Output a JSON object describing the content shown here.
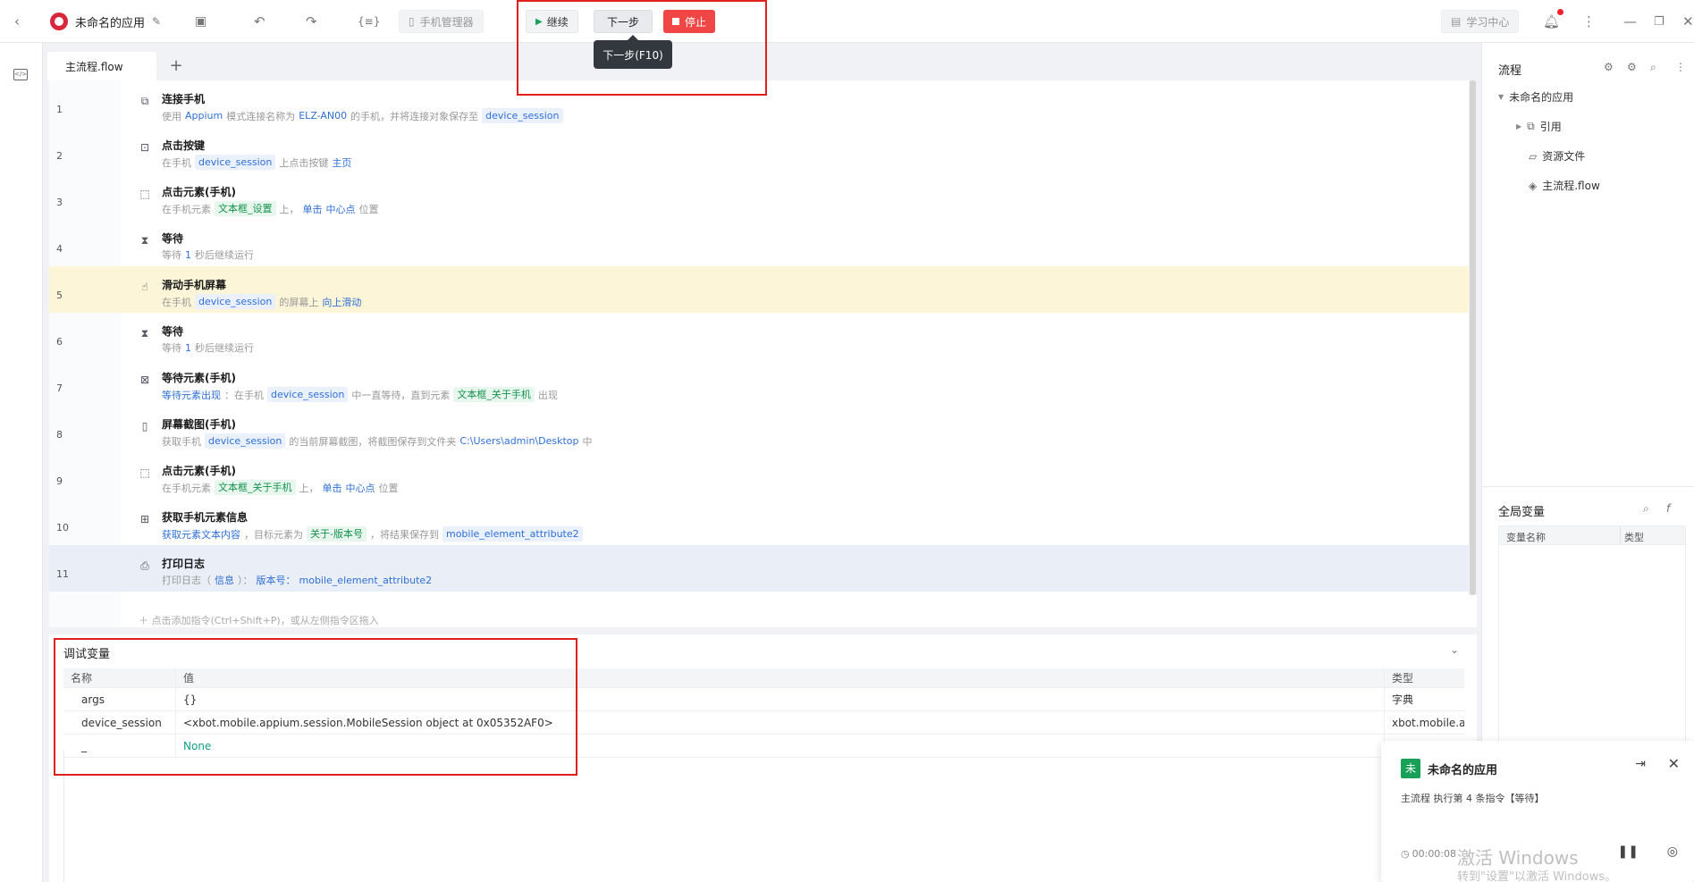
{
  "app": {
    "name": "未命名的应用"
  },
  "toolbar": {
    "phone_manager": "手机管理器",
    "continue_label": "继续",
    "next_label": "下一步",
    "stop_label": "停止",
    "next_tooltip": "下一步(F10)",
    "learning_center": "学习中心"
  },
  "tabs": {
    "active": "主流程.flow"
  },
  "flow": [
    {
      "num": "1",
      "icon": "connect-phone-icon",
      "title": "连接手机",
      "desc": [
        {
          "t": "使用"
        },
        {
          "t": "Appium",
          "k": "kw"
        },
        {
          "t": "模式连接名称为"
        },
        {
          "t": "ELZ-AN00",
          "k": "kw"
        },
        {
          "t": "的手机，并将连接对象保存至"
        },
        {
          "t": "device_session",
          "k": "tag"
        }
      ]
    },
    {
      "num": "2",
      "icon": "click-key-icon",
      "title": "点击按键",
      "desc": [
        {
          "t": "在手机"
        },
        {
          "t": "device_session",
          "k": "tag"
        },
        {
          "t": "上点击按键"
        },
        {
          "t": "主页",
          "k": "kw"
        }
      ]
    },
    {
      "num": "3",
      "icon": "click-element-icon",
      "title": "点击元素(手机)",
      "desc": [
        {
          "t": "在手机元素"
        },
        {
          "t": "文本框_设置",
          "k": "tagg"
        },
        {
          "t": "上，"
        },
        {
          "t": "单击",
          "k": "kw"
        },
        {
          "t": "中心点",
          "k": "kw"
        },
        {
          "t": "位置"
        }
      ]
    },
    {
      "num": "4",
      "icon": "hourglass-icon",
      "title": "等待",
      "desc": [
        {
          "t": "等待"
        },
        {
          "t": "1",
          "k": "kw"
        },
        {
          "t": "秒后继续运行"
        }
      ]
    },
    {
      "num": "5",
      "icon": "swipe-icon",
      "title": "滑动手机屏幕",
      "desc": [
        {
          "t": "在手机"
        },
        {
          "t": "device_session",
          "k": "tag"
        },
        {
          "t": "的屏幕上"
        },
        {
          "t": "向上滑动",
          "k": "kw"
        }
      ]
    },
    {
      "num": "6",
      "icon": "hourglass-icon",
      "title": "等待",
      "desc": [
        {
          "t": "等待"
        },
        {
          "t": "1",
          "k": "kw"
        },
        {
          "t": "秒后继续运行"
        }
      ]
    },
    {
      "num": "7",
      "icon": "wait-element-icon",
      "title": "等待元素(手机)",
      "desc": [
        {
          "t": "等待元素出现",
          "k": "kw"
        },
        {
          "t": "：在手机"
        },
        {
          "t": "device_session",
          "k": "tag"
        },
        {
          "t": "中一直等待，直到元素"
        },
        {
          "t": "文本框_关于手机",
          "k": "tagg"
        },
        {
          "t": "出现"
        }
      ]
    },
    {
      "num": "8",
      "icon": "screenshot-icon",
      "title": "屏幕截图(手机)",
      "desc": [
        {
          "t": "获取手机"
        },
        {
          "t": "device_session",
          "k": "tag"
        },
        {
          "t": "的当前屏幕截图，将截图保存到文件夹"
        },
        {
          "t": "C:\\Users\\admin\\Desktop",
          "k": "kw"
        },
        {
          "t": "中"
        }
      ]
    },
    {
      "num": "9",
      "icon": "click-element-icon",
      "title": "点击元素(手机)",
      "desc": [
        {
          "t": "在手机元素"
        },
        {
          "t": "文本框_关于手机",
          "k": "tagg"
        },
        {
          "t": "上，"
        },
        {
          "t": "单击",
          "k": "kw"
        },
        {
          "t": "中心点",
          "k": "kw"
        },
        {
          "t": "位置"
        }
      ]
    },
    {
      "num": "10",
      "icon": "element-info-icon",
      "title": "获取手机元素信息",
      "desc": [
        {
          "t": "获取元素文本内容",
          "k": "kw"
        },
        {
          "t": "，目标元素为"
        },
        {
          "t": "关于-版本号",
          "k": "tagg"
        },
        {
          "t": "，将结果保存到"
        },
        {
          "t": "mobile_element_attribute2",
          "k": "tag"
        }
      ]
    },
    {
      "num": "11",
      "icon": "print-log-icon",
      "title": "打印日志",
      "desc": [
        {
          "t": "打印日志（"
        },
        {
          "t": "信息",
          "k": "kw"
        },
        {
          "t": "）："
        },
        {
          "t": "版本号：",
          "k": "kw"
        },
        {
          "t": "mobile_element_attribute2",
          "k": "kw"
        }
      ]
    }
  ],
  "add_hint": "＋ 点击添加指令(Ctrl+Shift+P)，或从左侧指令区拖入",
  "debug": {
    "title": "调试变量",
    "headers": {
      "name": "名称",
      "value": "值",
      "type": "类型"
    },
    "rows": [
      {
        "name": "args",
        "value": "{}",
        "type": "字典"
      },
      {
        "name": "device_session",
        "value": "<xbot.mobile.appium.session.MobileSession object at 0x05352AF0>",
        "type": "xbot.mobile.a"
      },
      {
        "name": "_",
        "value": "None",
        "type": ""
      }
    ]
  },
  "right": {
    "flow_title": "流程",
    "tree": {
      "root": "未命名的应用",
      "ref": "引用",
      "resources": "资源文件",
      "main": "主流程.flow"
    },
    "global_vars": {
      "title": "全局变量",
      "col_name": "变量名称",
      "col_type": "类型"
    }
  },
  "toast": {
    "logo": "未",
    "name": "未命名的应用",
    "message": "主流程 执行第 4 条指令【等待】",
    "time": "00:00:08"
  },
  "watermark": {
    "line1": "激活 Windows",
    "line2": "转到\"设置\"以激活 Windows。"
  }
}
